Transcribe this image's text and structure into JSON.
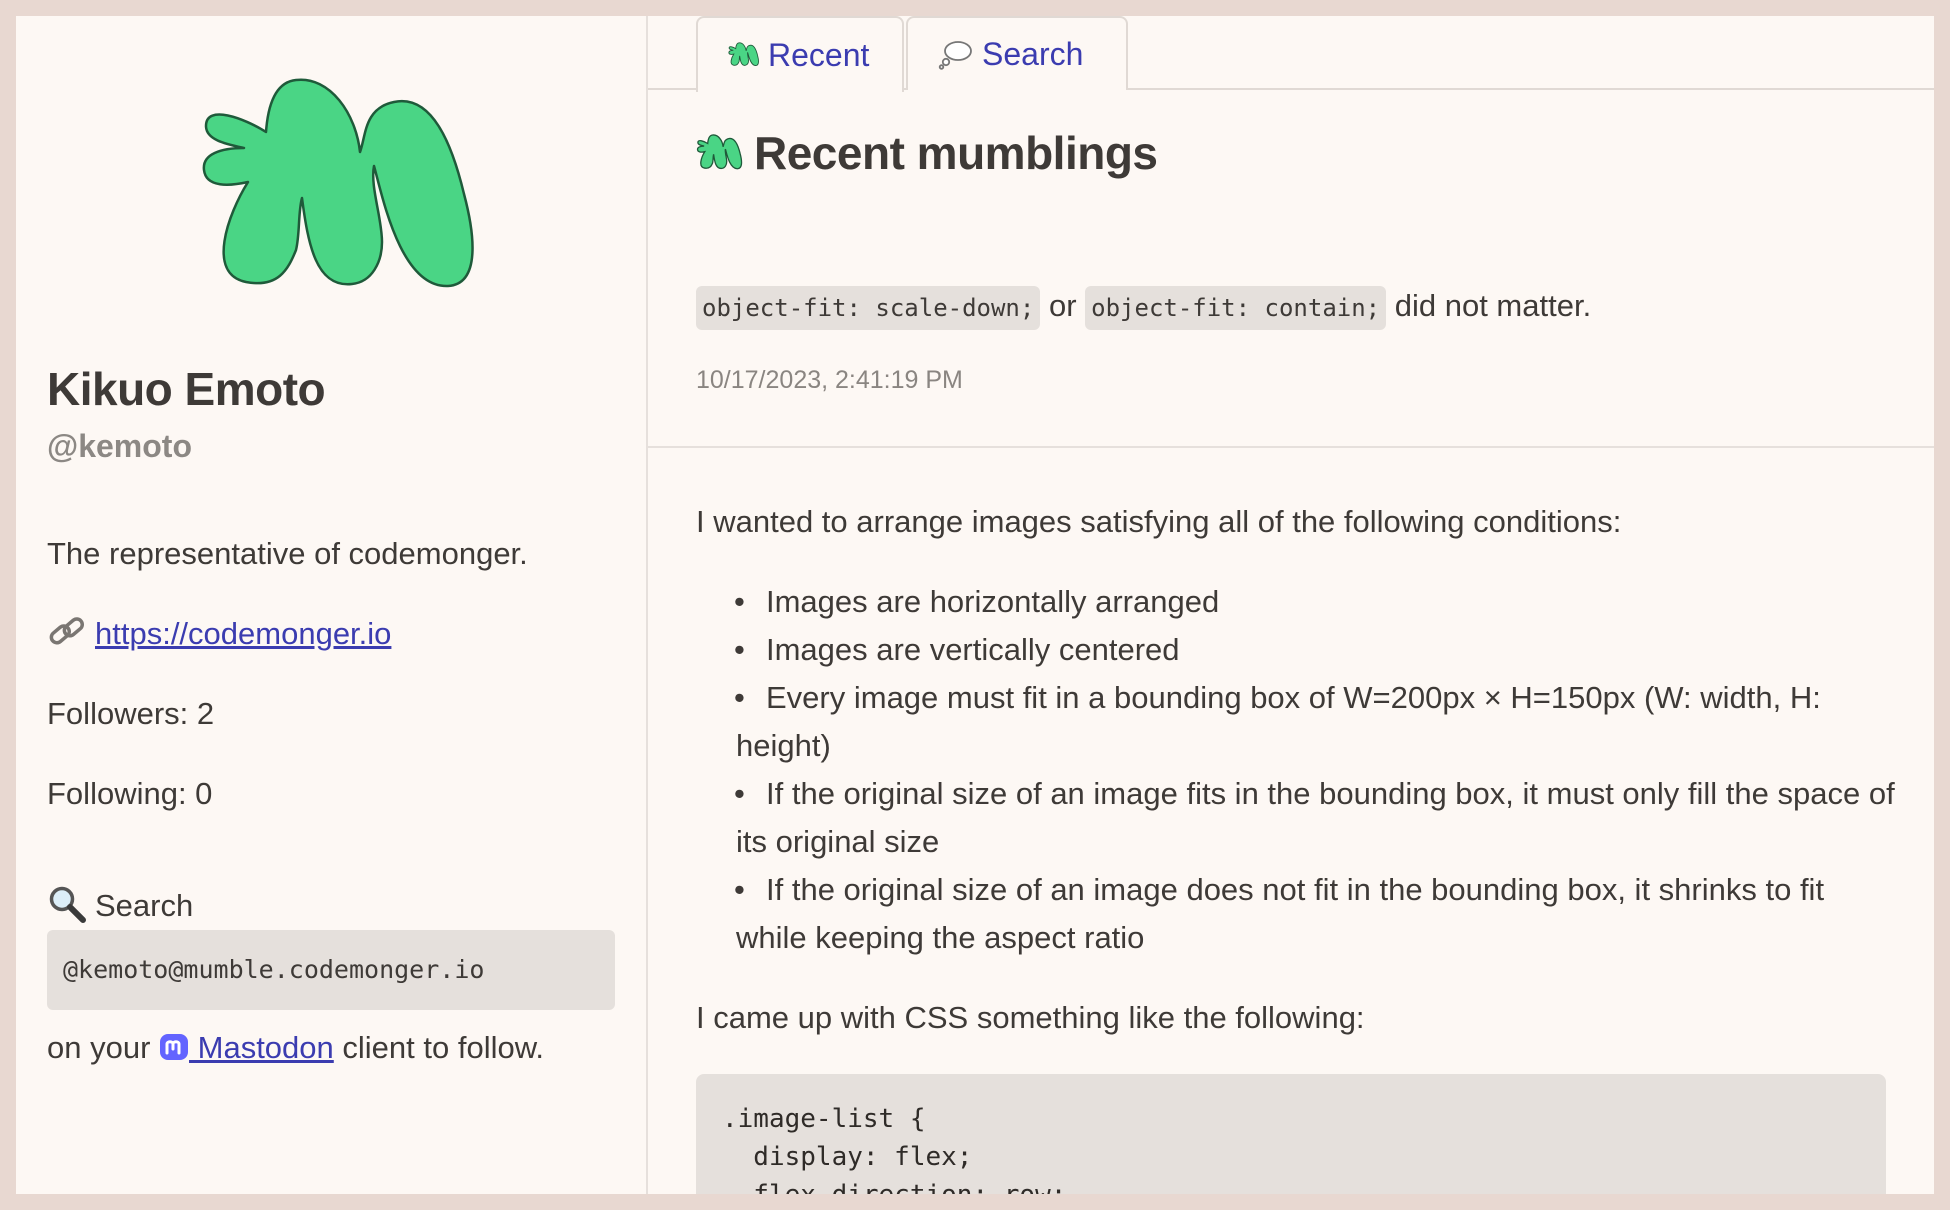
{
  "colors": {
    "page_border": "#e8d8d1",
    "background": "#fdf8f4",
    "text": "#3e3a37",
    "muted": "#8a8581",
    "link": "#3b3cb0",
    "code_bg": "#e5e0dc",
    "logo_green": "#4ad585",
    "mastodon_purple": "#6364ff"
  },
  "profile": {
    "logo_icon": "mumble-logo-icon",
    "name": "Kikuo Emoto",
    "handle": "@kemoto",
    "bio": "The representative of codemonger.",
    "link_icon": "link-icon",
    "website": "https://codemonger.io",
    "followers": "Followers: 2",
    "following": "Following: 0",
    "search_icon": "magnifier-icon",
    "search_label": "Search",
    "account": "@kemoto@mumble.codemonger.io",
    "follow_prefix": "on your ",
    "mastodon_icon": "mastodon-icon",
    "mastodon_label": " Mastodon",
    "follow_suffix": " client to follow."
  },
  "tabs": [
    {
      "label": "Recent",
      "icon": "mumble-logo-icon",
      "active": true
    },
    {
      "label": "Search",
      "icon": "thought-balloon-icon",
      "active": false
    }
  ],
  "main": {
    "heading": "Recent mumblings",
    "post1": {
      "code_a": "object-fit: scale-down;",
      "connector": " or ",
      "code_b": "object-fit: contain;",
      "suffix": " did not matter.",
      "timestamp": "10/17/2023, 2:41:19 PM"
    },
    "post2": {
      "intro": "I wanted to arrange images satisfying all of the following conditions:",
      "conditions": [
        "Images are horizontally arranged",
        "Images are vertically centered",
        "Every image must fit in a bounding box of W=200px × H=150px (W: width, H: height)",
        "If the original size of an image fits in the bounding box, it must only fill the space of its original size",
        "If the original size of an image does not fit in the bounding box, it shrinks to fit while keeping the aspect ratio"
      ],
      "outro": "I came up with CSS something like the following:",
      "code": ".image-list {\n  display: flex;\n  flex-direction: row;"
    }
  }
}
